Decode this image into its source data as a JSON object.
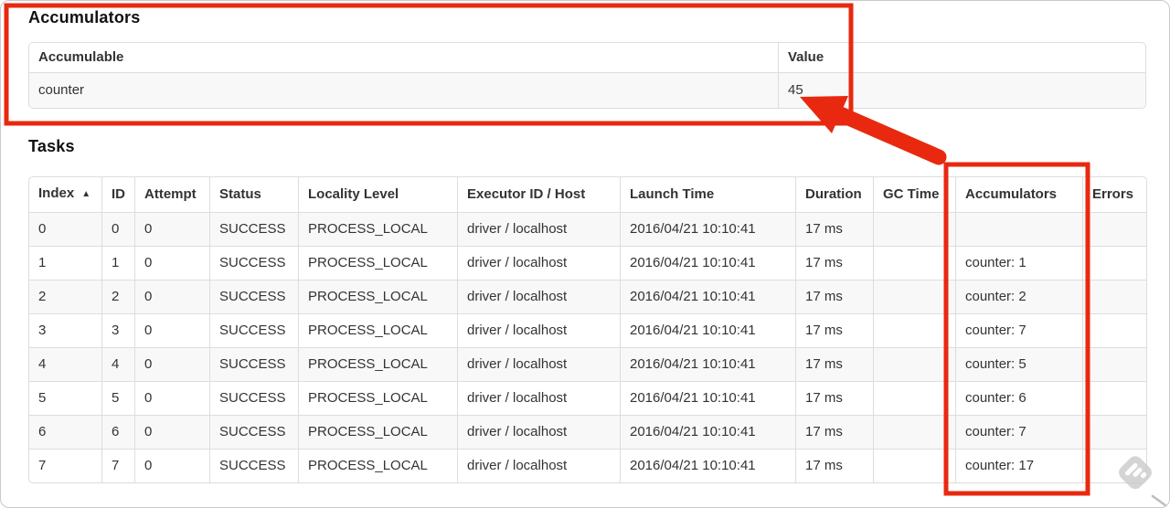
{
  "annotations": {
    "color": "#e8290f",
    "arrow_target": "45",
    "watermark_color": "#c6c6c6",
    "tick_color": "#bdbdbd"
  },
  "accumulators": {
    "heading": "Accumulators",
    "columns": {
      "accumulable": "Accumulable",
      "value": "Value"
    },
    "rows": [
      {
        "accumulable": "counter",
        "value": "45"
      }
    ]
  },
  "tasks": {
    "heading": "Tasks",
    "sort_icon": "▲",
    "columns": {
      "index": "Index",
      "id": "ID",
      "attempt": "Attempt",
      "status": "Status",
      "locality_level": "Locality Level",
      "executor_id_host": "Executor ID / Host",
      "launch_time": "Launch Time",
      "duration": "Duration",
      "gc_time": "GC Time",
      "accumulators": "Accumulators",
      "errors": "Errors"
    },
    "rows": [
      {
        "index": "0",
        "id": "0",
        "attempt": "0",
        "status": "SUCCESS",
        "locality_level": "PROCESS_LOCAL",
        "executor_id_host": "driver / localhost",
        "launch_time": "2016/04/21 10:10:41",
        "duration": "17 ms",
        "gc_time": "",
        "accumulators": "",
        "errors": ""
      },
      {
        "index": "1",
        "id": "1",
        "attempt": "0",
        "status": "SUCCESS",
        "locality_level": "PROCESS_LOCAL",
        "executor_id_host": "driver / localhost",
        "launch_time": "2016/04/21 10:10:41",
        "duration": "17 ms",
        "gc_time": "",
        "accumulators": "counter: 1",
        "errors": ""
      },
      {
        "index": "2",
        "id": "2",
        "attempt": "0",
        "status": "SUCCESS",
        "locality_level": "PROCESS_LOCAL",
        "executor_id_host": "driver / localhost",
        "launch_time": "2016/04/21 10:10:41",
        "duration": "17 ms",
        "gc_time": "",
        "accumulators": "counter: 2",
        "errors": ""
      },
      {
        "index": "3",
        "id": "3",
        "attempt": "0",
        "status": "SUCCESS",
        "locality_level": "PROCESS_LOCAL",
        "executor_id_host": "driver / localhost",
        "launch_time": "2016/04/21 10:10:41",
        "duration": "17 ms",
        "gc_time": "",
        "accumulators": "counter: 7",
        "errors": ""
      },
      {
        "index": "4",
        "id": "4",
        "attempt": "0",
        "status": "SUCCESS",
        "locality_level": "PROCESS_LOCAL",
        "executor_id_host": "driver / localhost",
        "launch_time": "2016/04/21 10:10:41",
        "duration": "17 ms",
        "gc_time": "",
        "accumulators": "counter: 5",
        "errors": ""
      },
      {
        "index": "5",
        "id": "5",
        "attempt": "0",
        "status": "SUCCESS",
        "locality_level": "PROCESS_LOCAL",
        "executor_id_host": "driver / localhost",
        "launch_time": "2016/04/21 10:10:41",
        "duration": "17 ms",
        "gc_time": "",
        "accumulators": "counter: 6",
        "errors": ""
      },
      {
        "index": "6",
        "id": "6",
        "attempt": "0",
        "status": "SUCCESS",
        "locality_level": "PROCESS_LOCAL",
        "executor_id_host": "driver / localhost",
        "launch_time": "2016/04/21 10:10:41",
        "duration": "17 ms",
        "gc_time": "",
        "accumulators": "counter: 7",
        "errors": ""
      },
      {
        "index": "7",
        "id": "7",
        "attempt": "0",
        "status": "SUCCESS",
        "locality_level": "PROCESS_LOCAL",
        "executor_id_host": "driver / localhost",
        "launch_time": "2016/04/21 10:10:41",
        "duration": "17 ms",
        "gc_time": "",
        "accumulators": "counter: 17",
        "errors": ""
      }
    ]
  }
}
